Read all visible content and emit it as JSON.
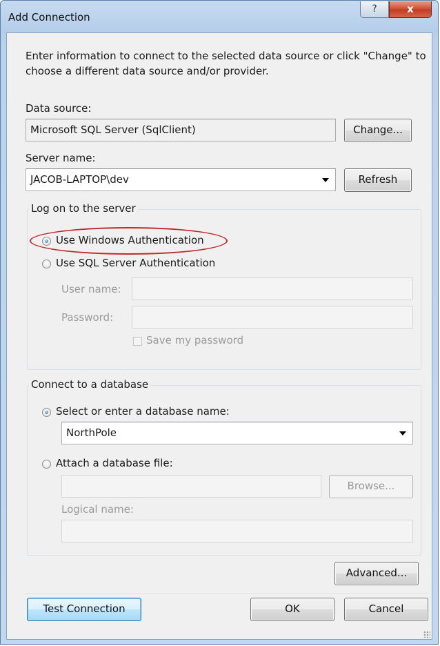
{
  "window": {
    "title": "Add Connection",
    "help_glyph": "?",
    "close_glyph": "x"
  },
  "intro": "Enter information to connect to the selected data source or click \"Change\" to choose a different data source and/or provider.",
  "data_source": {
    "label": "Data source:",
    "value": "Microsoft SQL Server (SqlClient)",
    "change_button": "Change..."
  },
  "server": {
    "label": "Server name:",
    "value": "JACOB-LAPTOP\\dev",
    "refresh_button": "Refresh"
  },
  "logon": {
    "title": "Log on to the server",
    "windows_auth_label": "Use Windows Authentication",
    "sql_auth_label": "Use SQL Server Authentication",
    "selected": "windows",
    "username_label": "User name:",
    "username_value": "",
    "password_label": "Password:",
    "password_value": "",
    "save_password_label": "Save my password"
  },
  "database": {
    "title": "Connect to a database",
    "select_label": "Select or enter a database name:",
    "select_value": "NorthPole",
    "attach_label": "Attach a database file:",
    "attach_value": "",
    "browse_button": "Browse...",
    "logical_name_label": "Logical name:",
    "logical_name_value": "",
    "selected": "select"
  },
  "buttons": {
    "advanced": "Advanced...",
    "test_connection": "Test Connection",
    "ok": "OK",
    "cancel": "Cancel"
  },
  "colors": {
    "highlight": "#c0282b",
    "title_gradient": "#b4cde9",
    "close_button": "#c23a21"
  },
  "icons": {
    "help": "help-icon",
    "close": "close-icon",
    "dropdown": "chevron-down-icon"
  }
}
